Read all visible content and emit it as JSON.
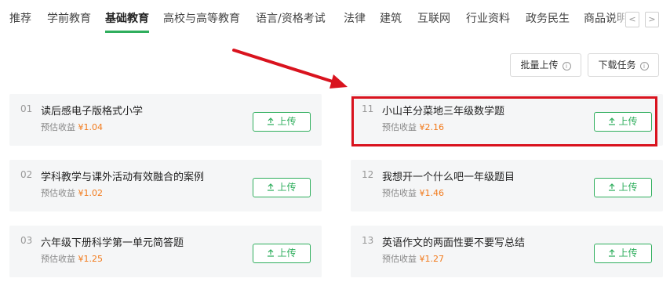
{
  "tabs": [
    {
      "label": "推荐"
    },
    {
      "label": "学前教育"
    },
    {
      "label": "基础教育",
      "active": true
    },
    {
      "label": "高校与高等教育"
    },
    {
      "label": "语言/资格考试"
    },
    {
      "label": "法律"
    },
    {
      "label": "建筑"
    },
    {
      "label": "互联网"
    },
    {
      "label": "行业资料"
    },
    {
      "label": "政务民生"
    },
    {
      "label": "商品说明"
    }
  ],
  "nav": {
    "prev_glyph": "<",
    "next_glyph": ">"
  },
  "toolbar": {
    "batch_upload": "批量上传",
    "download_tasks": "下载任务",
    "info_glyph": "i"
  },
  "colors": {
    "accent": "#2fae5d",
    "earning": "#f27a1b",
    "annotation": "#d9131e"
  },
  "earning_prefix": "预估收益",
  "upload_label": "上传",
  "items": [
    {
      "num": "01",
      "title": "读后感电子版格式小学",
      "amount": "¥1.04"
    },
    {
      "num": "02",
      "title": "学科教学与课外活动有效融合的案例",
      "amount": "¥1.02"
    },
    {
      "num": "03",
      "title": "六年级下册科学第一单元简答题",
      "amount": "¥1.25"
    },
    {
      "num": "11",
      "title": "小山羊分菜地三年级数学题",
      "amount": "¥2.16",
      "highlighted": true
    },
    {
      "num": "12",
      "title": "我想开一个什么吧一年级题目",
      "amount": "¥1.46"
    },
    {
      "num": "13",
      "title": "英语作文的两面性要不要写总结",
      "amount": "¥1.27"
    }
  ]
}
